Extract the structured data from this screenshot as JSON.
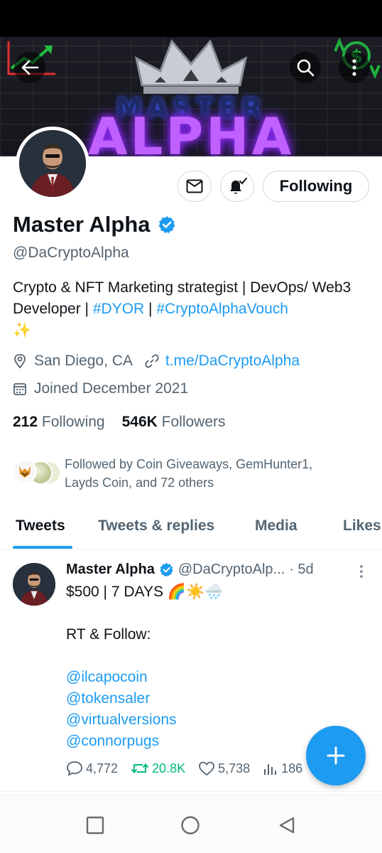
{
  "banner": {
    "subtitle": "MASTER",
    "title": "ALPHA"
  },
  "profile": {
    "display_name": "Master Alpha",
    "handle": "@DaCryptoAlpha",
    "following_button": "Following",
    "bio_text": "Crypto & NFT Marketing strategist | DevOps/ Web3 Developer | ",
    "bio_tag1": "#DYOR",
    "bio_sep": " | ",
    "bio_tag2": "#CryptoAlphaVouch",
    "bio_emoji": "✨",
    "location": "San Diego, CA",
    "website": "t.me/DaCryptoAlpha",
    "joined": "Joined December 2021",
    "following_count": "212",
    "following_label": "Following",
    "followers_count": "546K",
    "followers_label": "Followers",
    "followed_by_line1": "Followed by Coin Giveaways, GemHunter1,",
    "followed_by_line2": "Layds Coin, and 72 others"
  },
  "tabs": [
    {
      "label": "Tweets"
    },
    {
      "label": "Tweets & replies"
    },
    {
      "label": "Media"
    },
    {
      "label": "Likes"
    }
  ],
  "tweet": {
    "name": "Master Alpha",
    "handle": "@DaCryptoAlp...",
    "time": "· 5d",
    "line1": "$500 | 7 DAYS 🌈☀️🌧️",
    "line2": "RT & Follow:",
    "mentions": [
      "@ilcapocoin",
      "@tokensaler",
      "@virtualversions",
      "@connorpugs"
    ],
    "replies": "4,772",
    "retweets": "20.8K",
    "likes": "5,738",
    "views": "186"
  },
  "colors": {
    "accent": "#1d9bf0",
    "retweet_active": "#00ba7c",
    "text_primary": "#0f1419",
    "text_secondary": "#536471"
  }
}
